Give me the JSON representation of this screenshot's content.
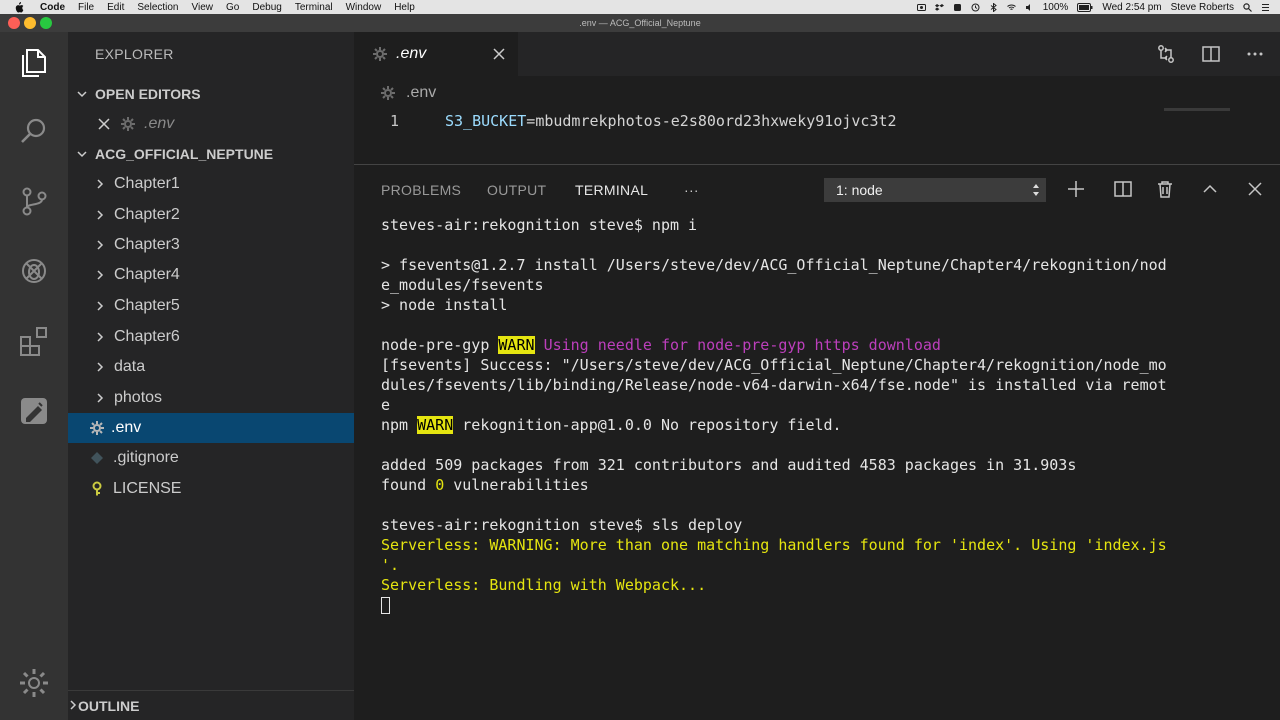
{
  "menubar": {
    "app": "Code",
    "items": [
      "File",
      "Edit",
      "Selection",
      "View",
      "Go",
      "Debug",
      "Terminal",
      "Window",
      "Help"
    ],
    "battery": "100%",
    "clock": "Wed 2:54 pm",
    "user": "Steve Roberts"
  },
  "window": {
    "title": ".env — ACG_Official_Neptune"
  },
  "sidebar": {
    "title": "EXPLORER",
    "open_editors": {
      "label": "OPEN EDITORS",
      "items": [
        ".env"
      ]
    },
    "project": {
      "label": "ACG_OFFICIAL_NEPTUNE",
      "folders": [
        "Chapter1",
        "Chapter2",
        "Chapter3",
        "Chapter4",
        "Chapter5",
        "Chapter6",
        "data",
        "photos"
      ],
      "files": [
        ".env",
        ".gitignore",
        "LICENSE"
      ]
    },
    "outline": "OUTLINE"
  },
  "editor": {
    "tab": ".env",
    "breadcrumb": ".env",
    "line_number": "1",
    "key": "S3_BUCKET",
    "equals": "=",
    "value": "mbudmrekphotos-e2s80ord23hxweky91ojvc3t2"
  },
  "panel": {
    "tabs": [
      "PROBLEMS",
      "OUTPUT",
      "TERMINAL"
    ],
    "more": "···",
    "terminal_select": "1: node"
  },
  "terminal": {
    "l1": "steves-air:rekognition steve$ npm i",
    "l2": "> fsevents@1.2.7 install /Users/steve/dev/ACG_Official_Neptune/Chapter4/rekognition/nod",
    "l3": "e_modules/fsevents",
    "l4": "> node install",
    "l5a": "node-pre-gyp",
    "l5b": "WARN",
    "l5c": "Using needle for node-pre-gyp https download",
    "l6": "[fsevents] Success: \"/Users/steve/dev/ACG_Official_Neptune/Chapter4/rekognition/node_mo",
    "l7": "dules/fsevents/lib/binding/Release/node-v64-darwin-x64/fse.node\" is installed via remot",
    "l8": "e",
    "l9a": "npm",
    "l9b": "WARN",
    "l9c": "rekognition-app@1.0.0 No repository field.",
    "l10": "added 509 packages from 321 contributors and audited 4583 packages in 31.903s",
    "l11a": "found ",
    "l11b": "0",
    "l11c": " vulnerabilities",
    "l12": "steves-air:rekognition steve$ sls deploy",
    "l13a": "Serverless: ",
    "l13b": "WARNING: More than one matching handlers found for 'index'. Using 'index.js",
    "l14": "'.",
    "l15a": "Serverless: ",
    "l15b": "Bundling with Webpack..."
  }
}
